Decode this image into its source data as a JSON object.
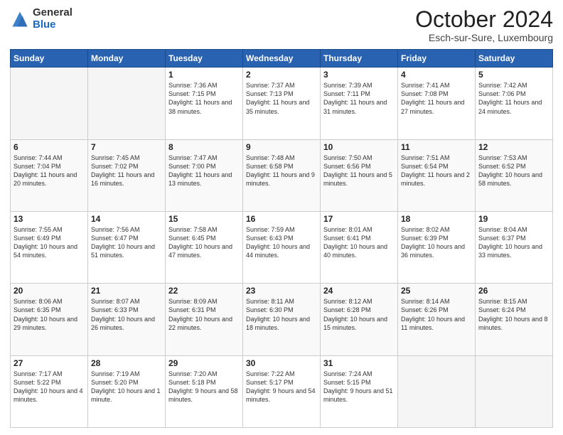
{
  "logo": {
    "general": "General",
    "blue": "Blue"
  },
  "header": {
    "month": "October 2024",
    "location": "Esch-sur-Sure, Luxembourg"
  },
  "weekdays": [
    "Sunday",
    "Monday",
    "Tuesday",
    "Wednesday",
    "Thursday",
    "Friday",
    "Saturday"
  ],
  "weeks": [
    [
      {
        "day": "",
        "info": ""
      },
      {
        "day": "",
        "info": ""
      },
      {
        "day": "1",
        "info": "Sunrise: 7:36 AM\nSunset: 7:15 PM\nDaylight: 11 hours and 38 minutes."
      },
      {
        "day": "2",
        "info": "Sunrise: 7:37 AM\nSunset: 7:13 PM\nDaylight: 11 hours and 35 minutes."
      },
      {
        "day": "3",
        "info": "Sunrise: 7:39 AM\nSunset: 7:11 PM\nDaylight: 11 hours and 31 minutes."
      },
      {
        "day": "4",
        "info": "Sunrise: 7:41 AM\nSunset: 7:08 PM\nDaylight: 11 hours and 27 minutes."
      },
      {
        "day": "5",
        "info": "Sunrise: 7:42 AM\nSunset: 7:06 PM\nDaylight: 11 hours and 24 minutes."
      }
    ],
    [
      {
        "day": "6",
        "info": "Sunrise: 7:44 AM\nSunset: 7:04 PM\nDaylight: 11 hours and 20 minutes."
      },
      {
        "day": "7",
        "info": "Sunrise: 7:45 AM\nSunset: 7:02 PM\nDaylight: 11 hours and 16 minutes."
      },
      {
        "day": "8",
        "info": "Sunrise: 7:47 AM\nSunset: 7:00 PM\nDaylight: 11 hours and 13 minutes."
      },
      {
        "day": "9",
        "info": "Sunrise: 7:48 AM\nSunset: 6:58 PM\nDaylight: 11 hours and 9 minutes."
      },
      {
        "day": "10",
        "info": "Sunrise: 7:50 AM\nSunset: 6:56 PM\nDaylight: 11 hours and 5 minutes."
      },
      {
        "day": "11",
        "info": "Sunrise: 7:51 AM\nSunset: 6:54 PM\nDaylight: 11 hours and 2 minutes."
      },
      {
        "day": "12",
        "info": "Sunrise: 7:53 AM\nSunset: 6:52 PM\nDaylight: 10 hours and 58 minutes."
      }
    ],
    [
      {
        "day": "13",
        "info": "Sunrise: 7:55 AM\nSunset: 6:49 PM\nDaylight: 10 hours and 54 minutes."
      },
      {
        "day": "14",
        "info": "Sunrise: 7:56 AM\nSunset: 6:47 PM\nDaylight: 10 hours and 51 minutes."
      },
      {
        "day": "15",
        "info": "Sunrise: 7:58 AM\nSunset: 6:45 PM\nDaylight: 10 hours and 47 minutes."
      },
      {
        "day": "16",
        "info": "Sunrise: 7:59 AM\nSunset: 6:43 PM\nDaylight: 10 hours and 44 minutes."
      },
      {
        "day": "17",
        "info": "Sunrise: 8:01 AM\nSunset: 6:41 PM\nDaylight: 10 hours and 40 minutes."
      },
      {
        "day": "18",
        "info": "Sunrise: 8:02 AM\nSunset: 6:39 PM\nDaylight: 10 hours and 36 minutes."
      },
      {
        "day": "19",
        "info": "Sunrise: 8:04 AM\nSunset: 6:37 PM\nDaylight: 10 hours and 33 minutes."
      }
    ],
    [
      {
        "day": "20",
        "info": "Sunrise: 8:06 AM\nSunset: 6:35 PM\nDaylight: 10 hours and 29 minutes."
      },
      {
        "day": "21",
        "info": "Sunrise: 8:07 AM\nSunset: 6:33 PM\nDaylight: 10 hours and 26 minutes."
      },
      {
        "day": "22",
        "info": "Sunrise: 8:09 AM\nSunset: 6:31 PM\nDaylight: 10 hours and 22 minutes."
      },
      {
        "day": "23",
        "info": "Sunrise: 8:11 AM\nSunset: 6:30 PM\nDaylight: 10 hours and 18 minutes."
      },
      {
        "day": "24",
        "info": "Sunrise: 8:12 AM\nSunset: 6:28 PM\nDaylight: 10 hours and 15 minutes."
      },
      {
        "day": "25",
        "info": "Sunrise: 8:14 AM\nSunset: 6:26 PM\nDaylight: 10 hours and 11 minutes."
      },
      {
        "day": "26",
        "info": "Sunrise: 8:15 AM\nSunset: 6:24 PM\nDaylight: 10 hours and 8 minutes."
      }
    ],
    [
      {
        "day": "27",
        "info": "Sunrise: 7:17 AM\nSunset: 5:22 PM\nDaylight: 10 hours and 4 minutes."
      },
      {
        "day": "28",
        "info": "Sunrise: 7:19 AM\nSunset: 5:20 PM\nDaylight: 10 hours and 1 minute."
      },
      {
        "day": "29",
        "info": "Sunrise: 7:20 AM\nSunset: 5:18 PM\nDaylight: 9 hours and 58 minutes."
      },
      {
        "day": "30",
        "info": "Sunrise: 7:22 AM\nSunset: 5:17 PM\nDaylight: 9 hours and 54 minutes."
      },
      {
        "day": "31",
        "info": "Sunrise: 7:24 AM\nSunset: 5:15 PM\nDaylight: 9 hours and 51 minutes."
      },
      {
        "day": "",
        "info": ""
      },
      {
        "day": "",
        "info": ""
      }
    ]
  ]
}
